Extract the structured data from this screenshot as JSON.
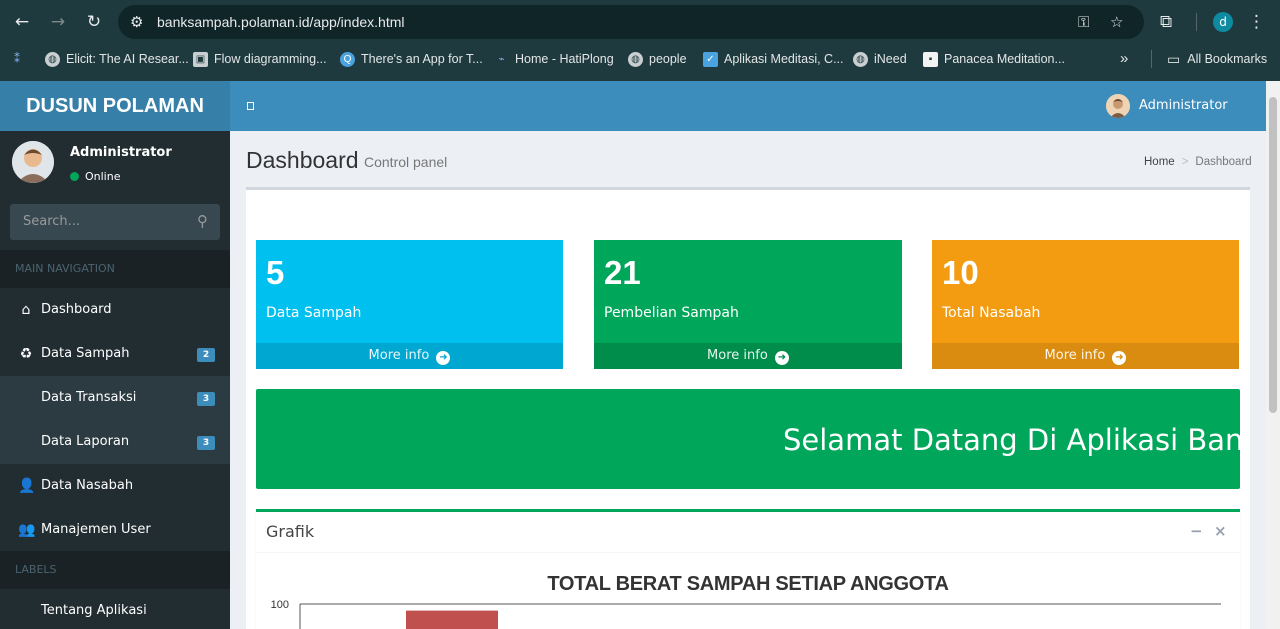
{
  "browser": {
    "url": "banksampah.polaman.id/app/index.html",
    "profile_initial": "d",
    "bookmarks": [
      {
        "label": "Elicit: The AI Resear...",
        "icon": "globe-icon"
      },
      {
        "label": "Flow diagramming...",
        "icon": "cube-icon"
      },
      {
        "label": "There's an App for T...",
        "icon": "search-q-icon"
      },
      {
        "label": "Home - HatiPlong",
        "icon": "hatiplong-icon"
      },
      {
        "label": "people",
        "icon": "globe-icon"
      },
      {
        "label": "Aplikasi Meditasi, C...",
        "icon": "check-icon"
      },
      {
        "label": "iNeed",
        "icon": "globe-icon"
      },
      {
        "label": "Panacea Meditation...",
        "icon": "page-icon"
      }
    ],
    "all_bookmarks": "All Bookmarks",
    "overflow": "»"
  },
  "app": {
    "logo": "DUSUN POLAMAN",
    "top_user": "Administrator"
  },
  "sidebar": {
    "user_name": "Administrator",
    "status": "Online",
    "search_placeholder": "Search...",
    "main_nav_label": "MAIN NAVIGATION",
    "items": [
      {
        "label": "Dashboard",
        "icon": "home-icon"
      },
      {
        "label": "Data Sampah",
        "icon": "recycle-icon",
        "badge": "2"
      },
      {
        "label": "Data Transaksi",
        "badge": "3"
      },
      {
        "label": "Data Laporan",
        "badge": "3"
      },
      {
        "label": "Data Nasabah",
        "icon": "user-icon"
      },
      {
        "label": "Manajemen User",
        "icon": "users-icon"
      }
    ],
    "labels_label": "LABELS",
    "about": "Tentang Aplikasi"
  },
  "content": {
    "title": "Dashboard",
    "subtitle": "Control panel",
    "breadcrumb": [
      "Home",
      "Dashboard"
    ]
  },
  "stats": [
    {
      "value": "5",
      "label": "Data Sampah",
      "more": "More info",
      "color": "#00c0ef",
      "foot_color": "#00a7d0"
    },
    {
      "value": "21",
      "label": "Pembelian Sampah",
      "more": "More info",
      "color": "#00a65a",
      "foot_color": "#008d4c"
    },
    {
      "value": "10",
      "label": "Total Nasabah",
      "more": "More info",
      "color": "#f39c12",
      "foot_color": "#da8c10"
    }
  ],
  "welcome": "Selamat Datang Di Aplikasi Bank Sa",
  "grafik": {
    "title": "Grafik",
    "chart_data": {
      "type": "bar",
      "title": "TOTAL BERAT SAMPAH SETIAP ANGGOTA",
      "ytick_labels": [
        "100"
      ],
      "visible_values": [
        97
      ],
      "bar_color": "#c0504d"
    }
  }
}
